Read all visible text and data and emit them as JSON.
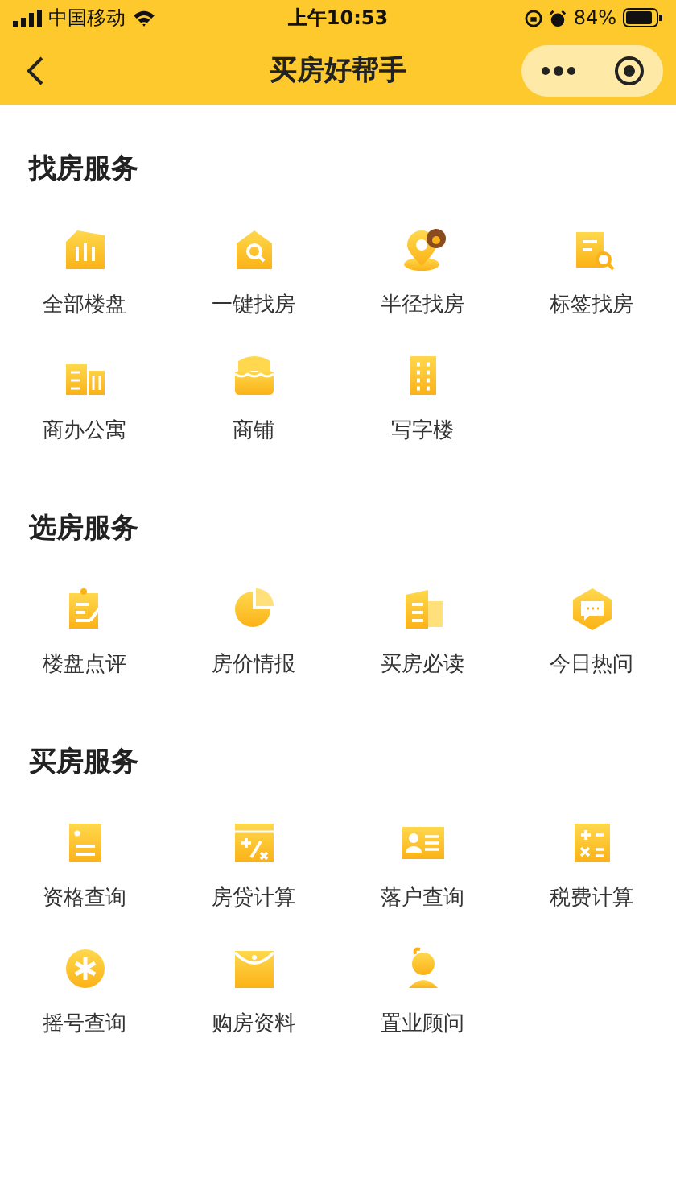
{
  "status_bar": {
    "carrier": "中国移动",
    "time": "上午10:53",
    "battery": "84%"
  },
  "nav": {
    "title": "买房好帮手"
  },
  "sections": [
    {
      "title": "找房服务",
      "items": [
        {
          "label": "全部楼盘"
        },
        {
          "label": "一键找房"
        },
        {
          "label": "半径找房"
        },
        {
          "label": "标签找房"
        },
        {
          "label": "商办公寓"
        },
        {
          "label": "商铺"
        },
        {
          "label": "写字楼"
        }
      ]
    },
    {
      "title": "选房服务",
      "items": [
        {
          "label": "楼盘点评"
        },
        {
          "label": "房价情报"
        },
        {
          "label": "买房必读"
        },
        {
          "label": "今日热问"
        }
      ]
    },
    {
      "title": "买房服务",
      "items": [
        {
          "label": "资格查询"
        },
        {
          "label": "房贷计算"
        },
        {
          "label": "落户查询"
        },
        {
          "label": "税费计算"
        },
        {
          "label": "摇号查询"
        },
        {
          "label": "购房资料"
        },
        {
          "label": "置业顾问"
        }
      ]
    }
  ]
}
